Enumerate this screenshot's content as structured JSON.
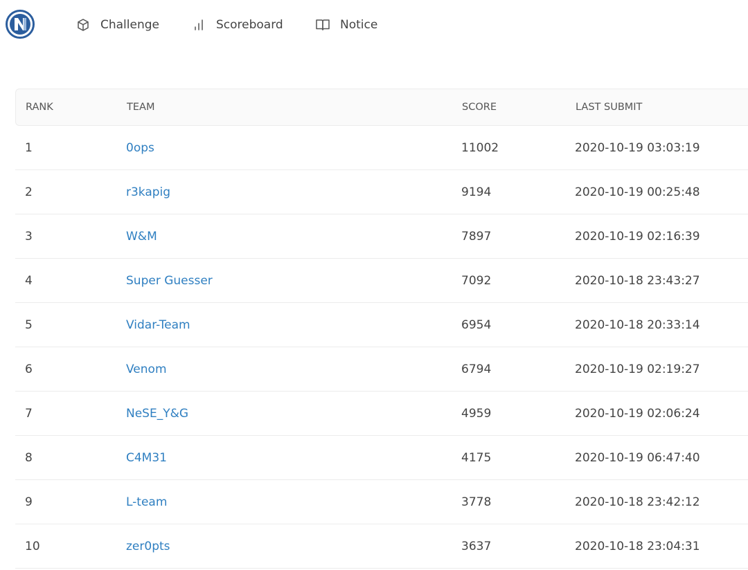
{
  "nav": {
    "items": [
      {
        "label": "Challenge",
        "icon": "cube-icon"
      },
      {
        "label": "Scoreboard",
        "icon": "bar-chart-icon"
      },
      {
        "label": "Notice",
        "icon": "book-icon"
      }
    ]
  },
  "colors": {
    "link": "#2f7fc1",
    "logo": "#2c5e9e",
    "header_bg": "#fafafa"
  },
  "table": {
    "headers": {
      "rank": "RANK",
      "team": "TEAM",
      "score": "SCORE",
      "last_submit": "LAST SUBMIT"
    },
    "rows": [
      {
        "rank": "1",
        "team": "0ops",
        "score": "11002",
        "last_submit": "2020-10-19 03:03:19"
      },
      {
        "rank": "2",
        "team": "r3kapig",
        "score": "9194",
        "last_submit": "2020-10-19 00:25:48"
      },
      {
        "rank": "3",
        "team": "W&M",
        "score": "7897",
        "last_submit": "2020-10-19 02:16:39"
      },
      {
        "rank": "4",
        "team": "Super Guesser",
        "score": "7092",
        "last_submit": "2020-10-18 23:43:27"
      },
      {
        "rank": "5",
        "team": "Vidar-Team",
        "score": "6954",
        "last_submit": "2020-10-18 20:33:14"
      },
      {
        "rank": "6",
        "team": "Venom",
        "score": "6794",
        "last_submit": "2020-10-19 02:19:27"
      },
      {
        "rank": "7",
        "team": "NeSE_Y&G",
        "score": "4959",
        "last_submit": "2020-10-19 02:06:24"
      },
      {
        "rank": "8",
        "team": "C4M31",
        "score": "4175",
        "last_submit": "2020-10-19 06:47:40"
      },
      {
        "rank": "9",
        "team": "L-team",
        "score": "3778",
        "last_submit": "2020-10-18 23:42:12"
      },
      {
        "rank": "10",
        "team": "zer0pts",
        "score": "3637",
        "last_submit": "2020-10-18 23:04:31"
      }
    ]
  }
}
